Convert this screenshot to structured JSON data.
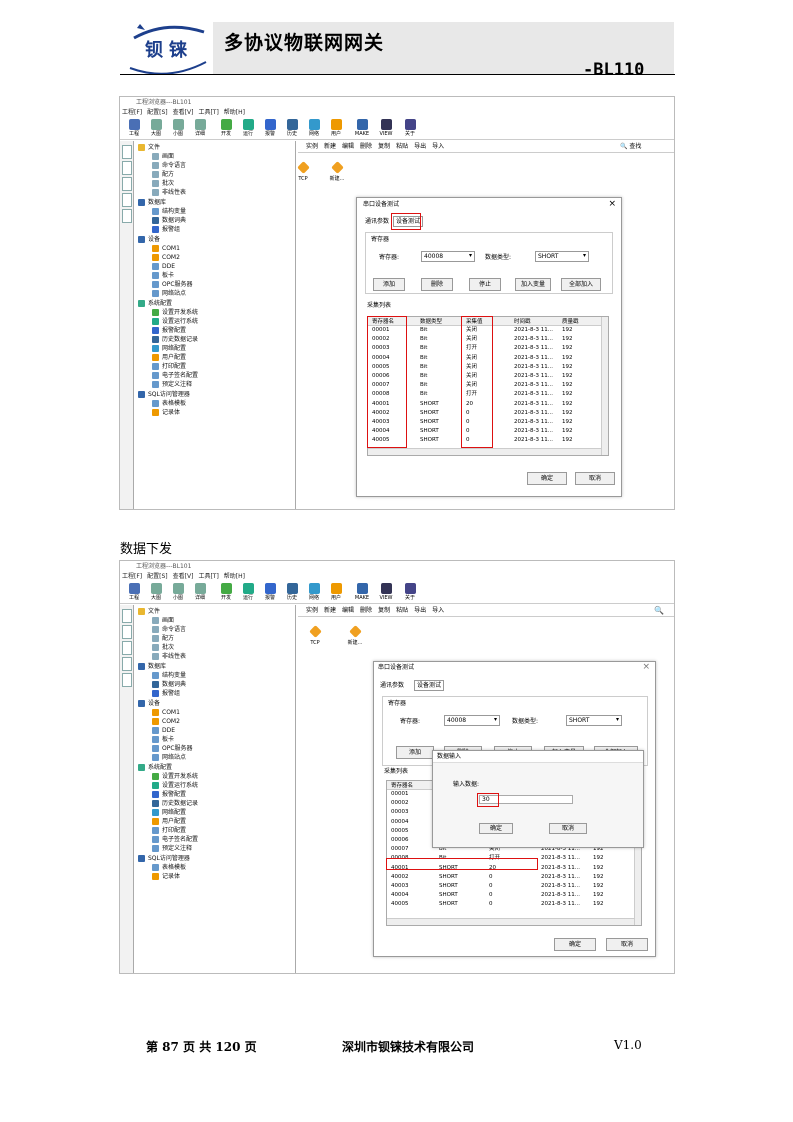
{
  "header": {
    "logo_text": "钡铼",
    "title": "多协议物联网网关",
    "model": "-BL110"
  },
  "app": {
    "title": "工程浏览器---BL101",
    "menu": [
      "工程[F]",
      "配置[S]",
      "查看[V]",
      "工具[T]",
      "帮助[H]"
    ],
    "toolbar": [
      "工程",
      "大图",
      "小图",
      "详细",
      "开发",
      "运行",
      "报警",
      "历史",
      "网络",
      "用户",
      "MAKE",
      "VIEW",
      "关于"
    ],
    "side_tabs": [
      "系统",
      "变量",
      "站点",
      "画面",
      "报表"
    ],
    "tree": [
      "文件",
      "画面",
      "命令语言",
      "配方",
      "批次",
      "非线性表",
      "数据库",
      "结构变量",
      "数据词典",
      "报警组",
      "设备",
      "COM1",
      "COM2",
      "DDE",
      "板卡",
      "OPC服务器",
      "网络站点",
      "系统配置",
      "设置开发系统",
      "设置运行系统",
      "报警配置",
      "历史数据记录",
      "网络配置",
      "用户配置",
      "打印配置",
      "电子签名配置",
      "预定义注释",
      "SQL访问管理器",
      "表格模板",
      "记录体"
    ],
    "right_toolbar": [
      "实例",
      "新建",
      "编辑",
      "删除",
      "复制",
      "粘贴",
      "导出",
      "导入"
    ],
    "search_label": "查找",
    "devices": [
      "TCP",
      "新建..."
    ]
  },
  "dialog": {
    "title": "串口设备测试",
    "tabs": [
      "通讯参数",
      "设备测试"
    ],
    "group_label": "寄存器",
    "register_label": "寄存器:",
    "register_value": "40008",
    "type_label": "数据类型:",
    "type_value": "SHORT",
    "buttons": [
      "添加",
      "删除",
      "停止",
      "加入变量",
      "全部加入"
    ],
    "list_label": "采集列表",
    "columns": [
      "寄存器名",
      "数据类型",
      "采集值",
      "时间戳",
      "质量戳"
    ],
    "rows": [
      [
        "00001",
        "Bit",
        "关闭",
        "2021-8-3 11...",
        "192"
      ],
      [
        "00002",
        "Bit",
        "关闭",
        "2021-8-3 11...",
        "192"
      ],
      [
        "00003",
        "Bit",
        "打开",
        "2021-8-3 11...",
        "192"
      ],
      [
        "00004",
        "Bit",
        "关闭",
        "2021-8-3 11...",
        "192"
      ],
      [
        "00005",
        "Bit",
        "关闭",
        "2021-8-3 11...",
        "192"
      ],
      [
        "00006",
        "Bit",
        "关闭",
        "2021-8-3 11...",
        "192"
      ],
      [
        "00007",
        "Bit",
        "关闭",
        "2021-8-3 11...",
        "192"
      ],
      [
        "00008",
        "Bit",
        "打开",
        "2021-8-3 11...",
        "192"
      ],
      [
        "40001",
        "SHORT",
        "20",
        "2021-8-3 11...",
        "192"
      ],
      [
        "40002",
        "SHORT",
        "0",
        "2021-8-3 11...",
        "192"
      ],
      [
        "40003",
        "SHORT",
        "0",
        "2021-8-3 11...",
        "192"
      ],
      [
        "40004",
        "SHORT",
        "0",
        "2021-8-3 11...",
        "192"
      ],
      [
        "40005",
        "SHORT",
        "0",
        "2021-8-3 11...",
        "192"
      ]
    ],
    "ok": "确定",
    "cancel": "取消"
  },
  "caption": "数据下发",
  "input_dialog": {
    "title": "数据输入",
    "label": "输入数据:",
    "value": "30",
    "ok": "确定",
    "cancel": "取消"
  },
  "footer": {
    "page": "第 87 页 共 120 页",
    "company": "深圳市钡铼技术有限公司",
    "version": "V1.0"
  },
  "colors": {
    "logo_blue": "#1d3f8c",
    "header_band": "#e8e8e8",
    "highlight_red": "#dd1111"
  }
}
